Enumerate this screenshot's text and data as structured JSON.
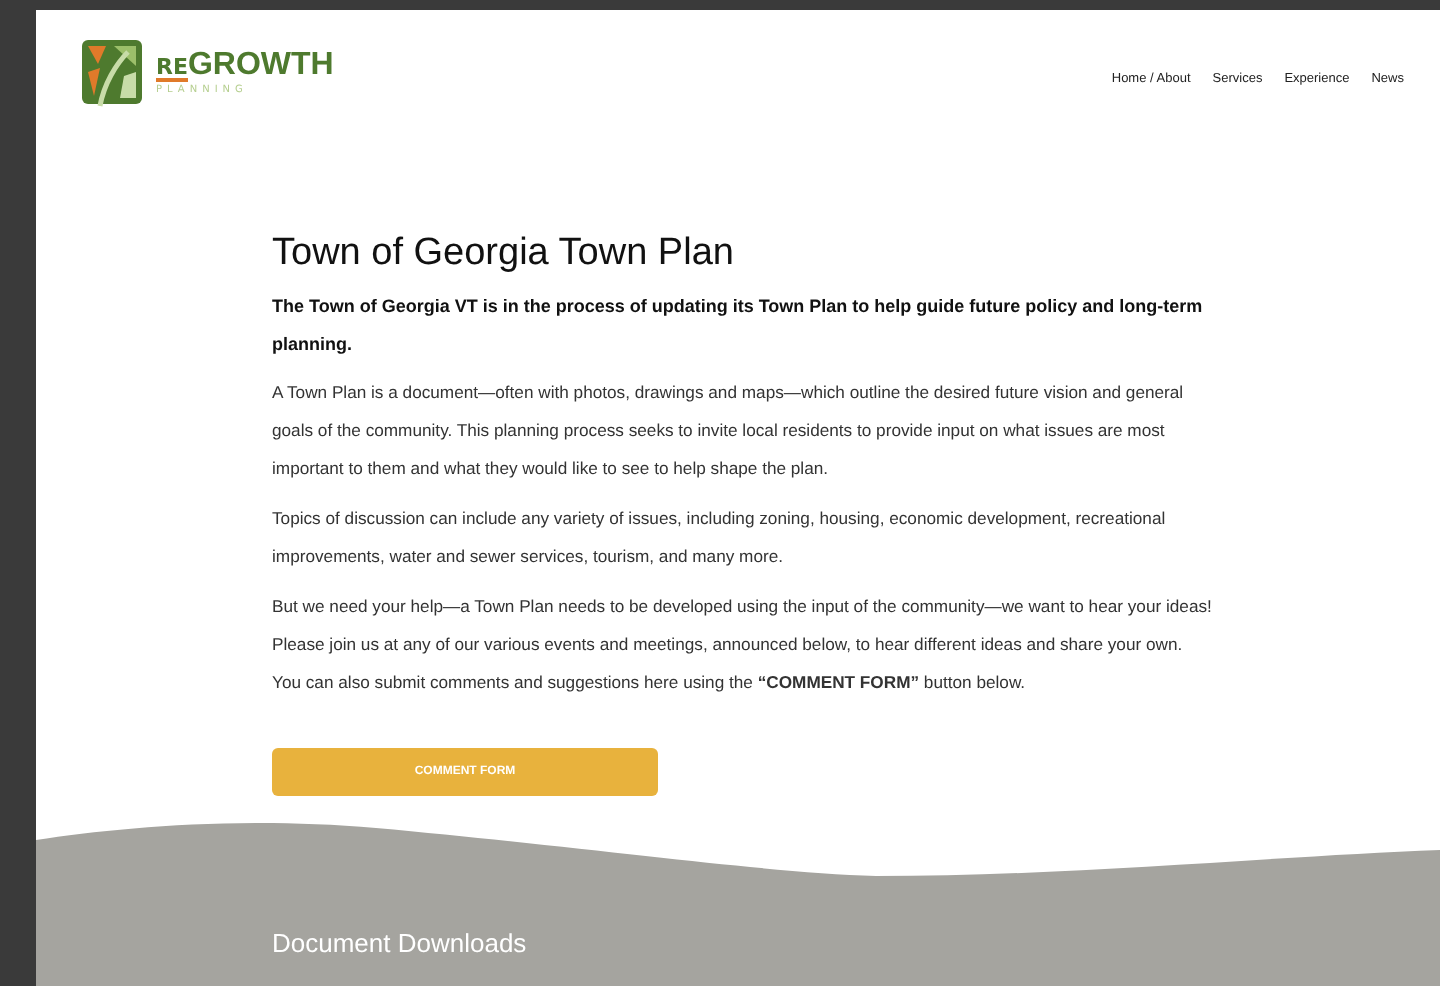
{
  "logo": {
    "prefix": "RE",
    "name": "GROWTH",
    "tagline": "PLANNING"
  },
  "nav": [
    {
      "label": "Home / About"
    },
    {
      "label": "Services"
    },
    {
      "label": "Experience"
    },
    {
      "label": "News"
    }
  ],
  "title": "Town of Georgia Town Plan",
  "lead": "The Town of Georgia VT is in the process of updating its Town Plan to help guide future policy and long-term planning.",
  "paragraphs": [
    "A Town Plan is a document—often with photos, drawings and maps—which outline the desired future vision and general goals of the community. This planning process seeks to invite local residents to provide input on what issues are most important to them and what they would like to see to help shape the plan.",
    "Topics of discussion can include any variety of issues, including zoning, housing, economic development, recreational improvements, water and sewer services, tourism, and many more.",
    "But we need your help—a Town Plan needs to be developed using the input of the community—we want to hear your ideas! Please join us at any of our various events and meetings, announced below, to hear different ideas and share your own. You can also submit comments and suggestions here using the **“COMMENT FORM”** button below."
  ],
  "button": "COMMENT FORM",
  "section_heading": "Document Downloads"
}
